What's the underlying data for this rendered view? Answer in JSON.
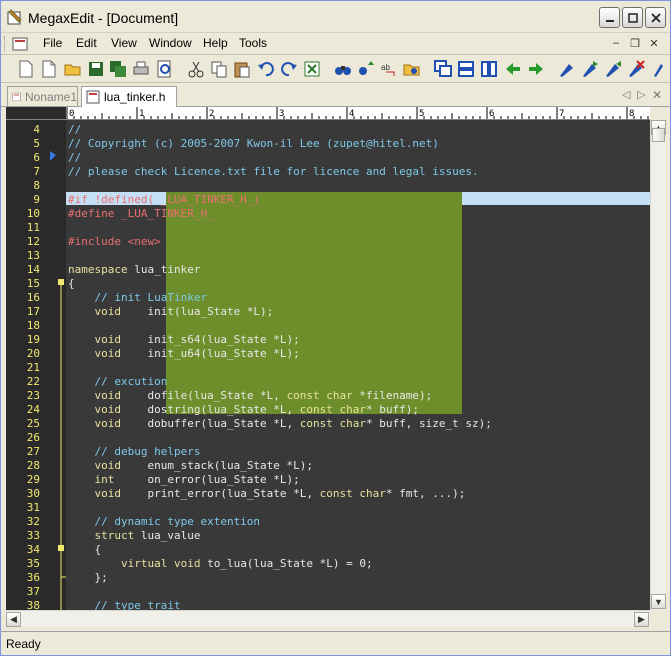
{
  "window": {
    "title": "MegaxEdit - [Document]",
    "icon": "app-icon"
  },
  "menubar": {
    "items": [
      "File",
      "Edit",
      "View",
      "Window",
      "Help",
      "Tools"
    ]
  },
  "tabs": [
    {
      "label": "Noname1",
      "active": false
    },
    {
      "label": "lua_tinker.h",
      "active": true
    }
  ],
  "ruler": {
    "marks": [
      "0",
      "1",
      "2",
      "3",
      "4",
      "5",
      "6",
      "7",
      "8"
    ]
  },
  "editor": {
    "lines": [
      {
        "n": "4",
        "parts": [
          [
            "com",
            "//"
          ]
        ]
      },
      {
        "n": "5",
        "parts": [
          [
            "com",
            "// Copyright (c) 2005-2007 Kwon-il Lee (zupet@hitel.net)"
          ]
        ]
      },
      {
        "n": "6",
        "parts": [
          [
            "com",
            "//"
          ]
        ]
      },
      {
        "n": "7",
        "parts": [
          [
            "com",
            "// please check Licence.txt file for licence and legal issues."
          ]
        ]
      },
      {
        "n": "8",
        "parts": []
      },
      {
        "n": "9",
        "parts": [
          [
            "pp",
            "#if !defined( _LUA_TINKER_H_)"
          ]
        ]
      },
      {
        "n": "10",
        "parts": [
          [
            "pp",
            "#define _LUA_TINKER_H_"
          ]
        ]
      },
      {
        "n": "11",
        "parts": []
      },
      {
        "n": "12",
        "parts": [
          [
            "pp",
            "#include <new>"
          ]
        ]
      },
      {
        "n": "13",
        "parts": []
      },
      {
        "n": "14",
        "parts": [
          [
            "kw",
            "namespace"
          ],
          [
            "txt",
            " lua_tinker"
          ]
        ]
      },
      {
        "n": "15",
        "parts": [
          [
            "txt",
            "{"
          ]
        ]
      },
      {
        "n": "16",
        "parts": [
          [
            "com",
            "    // init LuaTinker"
          ]
        ]
      },
      {
        "n": "17",
        "parts": [
          [
            "kw",
            "    void"
          ],
          [
            "txt",
            "    init(lua_State *L);"
          ]
        ]
      },
      {
        "n": "18",
        "parts": []
      },
      {
        "n": "19",
        "parts": [
          [
            "kw",
            "    void"
          ],
          [
            "txt",
            "    init_s64(lua_State *L);"
          ]
        ]
      },
      {
        "n": "20",
        "parts": [
          [
            "kw",
            "    void"
          ],
          [
            "txt",
            "    init_u64(lua_State *L);"
          ]
        ]
      },
      {
        "n": "21",
        "parts": []
      },
      {
        "n": "22",
        "parts": [
          [
            "com",
            "    // excution"
          ]
        ]
      },
      {
        "n": "23",
        "parts": [
          [
            "kw",
            "    void"
          ],
          [
            "txt",
            "    dofile(lua_State *L, "
          ],
          [
            "kw",
            "const char"
          ],
          [
            "txt",
            " *filename);"
          ]
        ]
      },
      {
        "n": "24",
        "parts": [
          [
            "kw",
            "    void"
          ],
          [
            "txt",
            "    dostring(lua_State *L, "
          ],
          [
            "kw",
            "const char"
          ],
          [
            "txt",
            "* buff);"
          ]
        ]
      },
      {
        "n": "25",
        "parts": [
          [
            "kw",
            "    void"
          ],
          [
            "txt",
            "    dobuffer(lua_State *L, "
          ],
          [
            "kw",
            "const char"
          ],
          [
            "txt",
            "* buff, size_t sz);"
          ]
        ]
      },
      {
        "n": "26",
        "parts": []
      },
      {
        "n": "27",
        "parts": [
          [
            "com",
            "    // debug helpers"
          ]
        ]
      },
      {
        "n": "28",
        "parts": [
          [
            "kw",
            "    void"
          ],
          [
            "txt",
            "    enum_stack(lua_State *L);"
          ]
        ]
      },
      {
        "n": "29",
        "parts": [
          [
            "kw",
            "    int"
          ],
          [
            "txt",
            "     on_error(lua_State *L);"
          ]
        ]
      },
      {
        "n": "30",
        "parts": [
          [
            "kw",
            "    void"
          ],
          [
            "txt",
            "    print_error(lua_State *L, "
          ],
          [
            "kw",
            "const char"
          ],
          [
            "txt",
            "* fmt, ...);"
          ]
        ]
      },
      {
        "n": "31",
        "parts": []
      },
      {
        "n": "32",
        "parts": [
          [
            "com",
            "    // dynamic type extention"
          ]
        ]
      },
      {
        "n": "33",
        "parts": [
          [
            "kw",
            "    struct"
          ],
          [
            "txt",
            " lua_value"
          ]
        ]
      },
      {
        "n": "34",
        "parts": [
          [
            "txt",
            "    {"
          ]
        ]
      },
      {
        "n": "35",
        "parts": [
          [
            "kw",
            "        virtual void"
          ],
          [
            "txt",
            " to_lua(lua_State *L) = 0;"
          ]
        ]
      },
      {
        "n": "36",
        "parts": [
          [
            "txt",
            "    };"
          ]
        ]
      },
      {
        "n": "37",
        "parts": []
      },
      {
        "n": "38",
        "parts": [
          [
            "com",
            "    // type trait"
          ]
        ]
      }
    ]
  },
  "statusbar": {
    "text": "Ready"
  },
  "colors": {
    "editor_bg": "#393939",
    "selection": "#6D8E2A",
    "line_number": "#F2E96E",
    "comment": "#7FC8E8",
    "preprocessor": "#E87070",
    "keyword": "#E8E0A0"
  }
}
